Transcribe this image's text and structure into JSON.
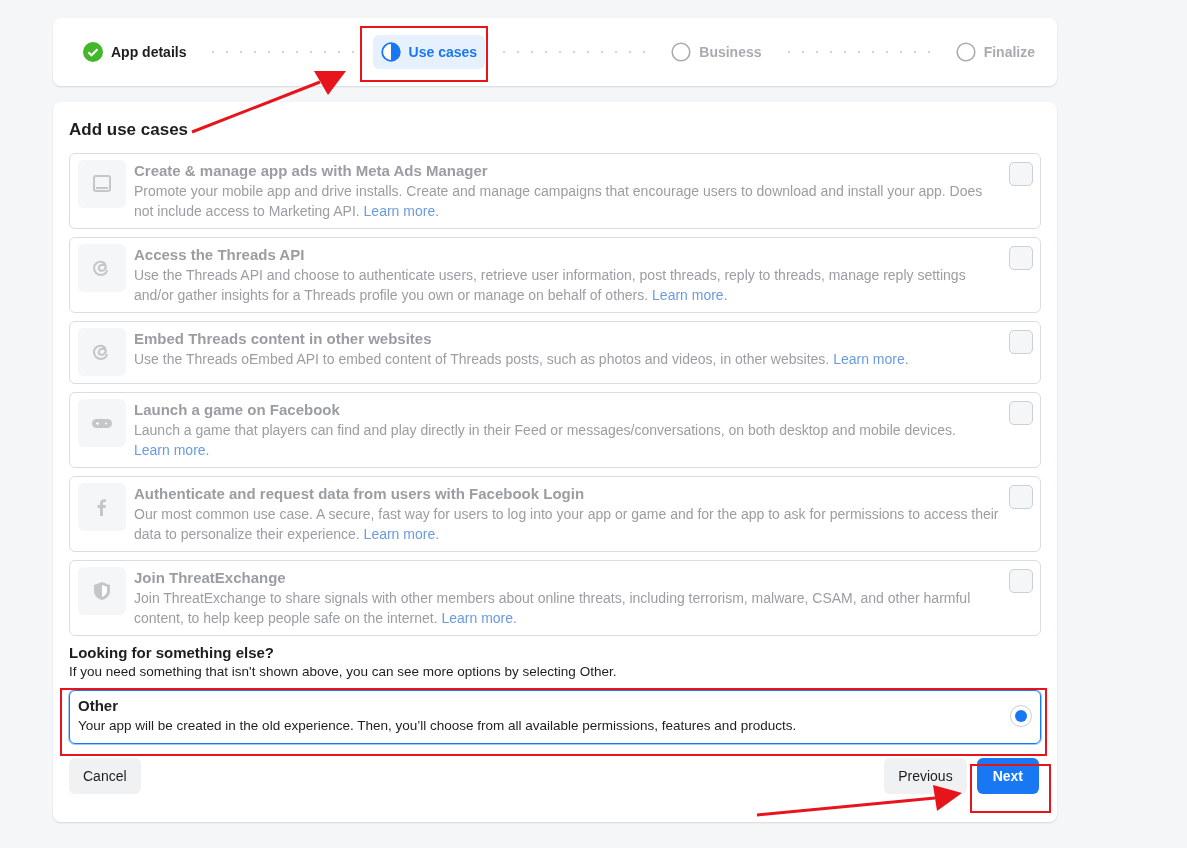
{
  "steps": [
    {
      "label": "App details",
      "completed": true,
      "selected": false
    },
    {
      "label": "Use cases",
      "completed": false,
      "selected": true
    },
    {
      "label": "Business",
      "completed": false,
      "selected": false
    },
    {
      "label": "Finalize",
      "completed": false,
      "selected": false
    }
  ],
  "heading": "Add use cases",
  "use_cases": [
    {
      "title": "Create & manage app ads with Meta Ads Manager",
      "description": "Promote your mobile app and drive installs. Create and manage campaigns that encourage users to download and install your app. Does not include access to Marketing API.",
      "link": "Learn more.",
      "checked": false,
      "disabled": true
    },
    {
      "title": "Access the Threads API",
      "description": "Use the Threads API and choose to authenticate users, retrieve user information, post threads, reply to threads, manage reply settings and/or gather insights for a Threads profile you own or manage on behalf of others.",
      "link": "Learn more.",
      "checked": false,
      "disabled": true
    },
    {
      "title": "Embed Threads content in other websites",
      "description": "Use the Threads oEmbed API to embed content of Threads posts, such as photos and videos, in other websites.",
      "link": "Learn more.",
      "checked": false,
      "disabled": true
    },
    {
      "title": "Launch a game on Facebook",
      "description": "Launch a game that players can find and play directly in their Feed or messages/conversations, on both desktop and mobile devices.",
      "link": "Learn more.",
      "checked": false,
      "disabled": true
    },
    {
      "title": "Authenticate and request data from users with Facebook Login",
      "description": "Our most common use case. A secure, fast way for users to log into your app or game and for the app to ask for permissions to access their data to personalize their experience.",
      "link": "Learn more.",
      "checked": false,
      "disabled": true
    },
    {
      "title": "Join ThreatExchange",
      "description": "Join ThreatExchange to share signals with other members about online threats, including terrorism, malware, CSAM, and other harmful content, to help keep people safe on the internet.",
      "link": "Learn more.",
      "checked": false,
      "disabled": true
    }
  ],
  "other_section": {
    "heading": "Looking for something else?",
    "hint": "If you need something that isn't shown above, you can see more options by selecting Other."
  },
  "other_option": {
    "title": "Other",
    "description": "Your app will be created in the old experience. Then, you’ll choose from all available permissions, features and products.",
    "selected": true
  },
  "buttons": [
    {
      "label": "Cancel",
      "kind": "secondary"
    },
    {
      "label": "Previous",
      "kind": "secondary"
    },
    {
      "label": "Next",
      "kind": "primary"
    }
  ]
}
